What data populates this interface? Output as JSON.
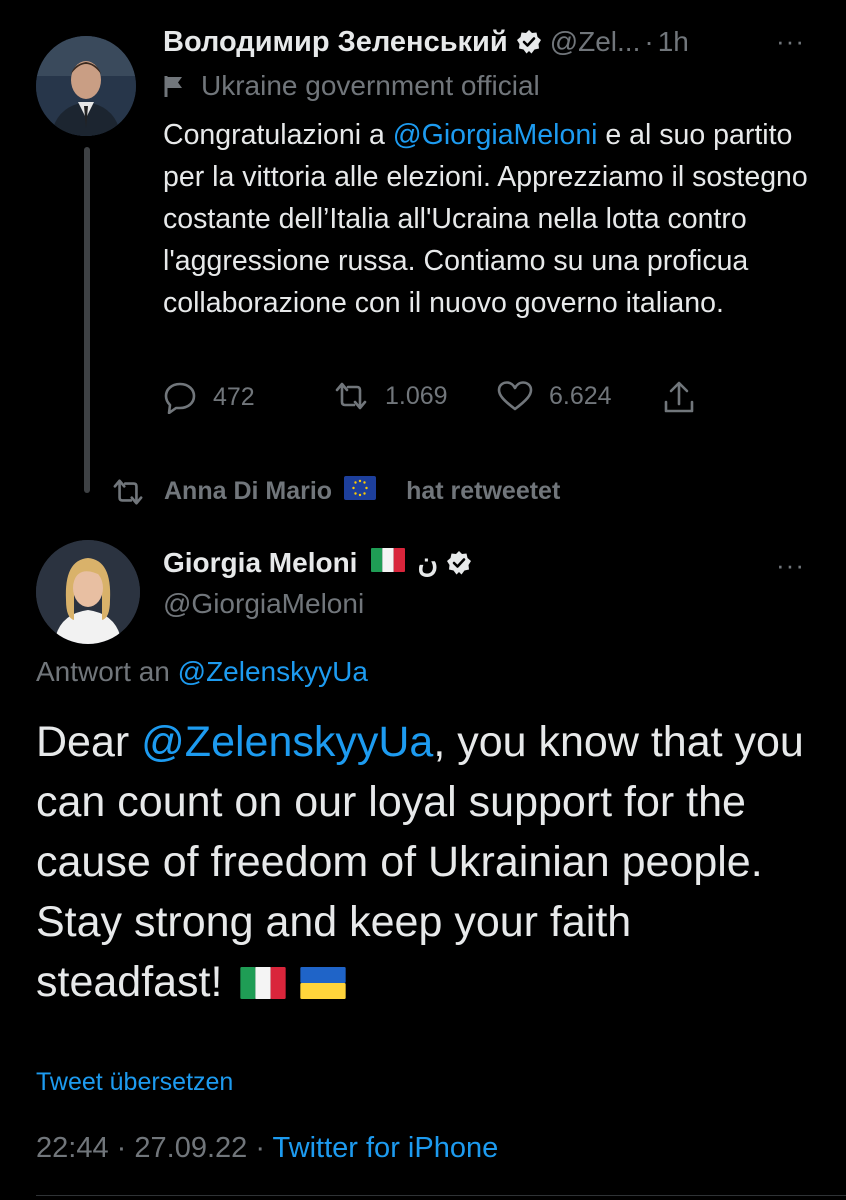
{
  "tweet1": {
    "author_name": "Володимир Зеленський",
    "handle": "@Zel...",
    "separator": "·",
    "time": "1h",
    "more": "···",
    "label": "Ukraine government official",
    "text": {
      "t1": "Congratulazioni a ",
      "mention": "@GiorgiaMeloni",
      "t2": " e al suo partito per la vittoria alle elezioni. Apprezziamo il sostegno costante dell’Italia all'Ucraina nella lotta contro l'aggressione russa. Contiamo su una proficua collaborazione con il nuovo governo italiano."
    },
    "replies": "472",
    "retweets": "1.069",
    "likes": "6.624"
  },
  "retweet_notice": {
    "user": "Anna Di Mario",
    "suffix": "hat retweetet"
  },
  "tweet2": {
    "author_name": "Giorgia Meloni",
    "name_symbol": "ن",
    "handle": "@GiorgiaMeloni",
    "more": "···",
    "reply_prefix": "Antwort an ",
    "reply_handle": "@ZelenskyyUa",
    "text": {
      "t1": "Dear ",
      "mention": "@ZelenskyyUa",
      "t2": ", you know that you can count on our loyal support for the cause of freedom of Ukrainian people. Stay strong and keep your faith steadfast! "
    },
    "translate": "Tweet übersetzen",
    "time": "22:44",
    "separator": "·",
    "date": "27.09.22",
    "source": "Twitter for iPhone"
  },
  "colors": {
    "background": "#000000",
    "link": "#1d9bf0",
    "muted": "#71767b",
    "text": "#e7e9ea"
  },
  "icons": [
    "flag-icon",
    "verified-badge-icon",
    "more-icon",
    "reply-icon",
    "retweet-icon",
    "like-icon",
    "share-icon",
    "eu-flag-icon",
    "italy-flag-icon",
    "ukraine-flag-icon"
  ]
}
